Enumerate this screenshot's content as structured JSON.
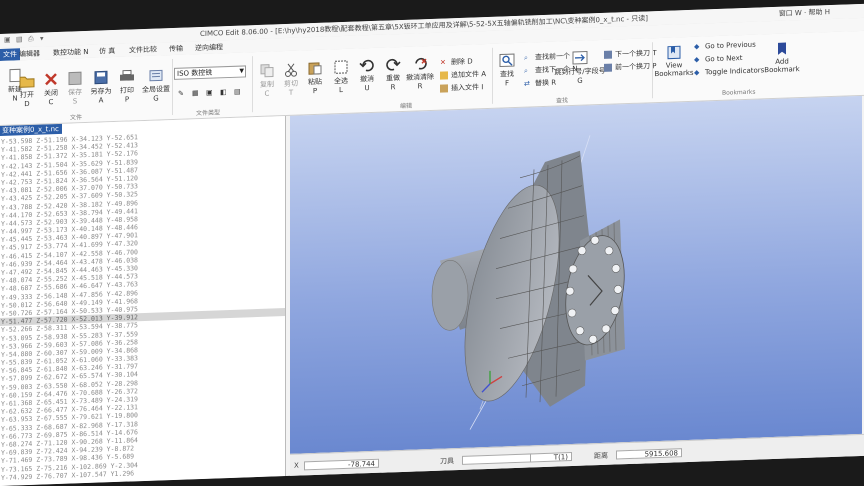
{
  "window": {
    "title": "CIMCO Edit 8.06.00 - [E:\\hy\\hy2018教程\\配套教程\\第五章\\5X钣环工单应用及详解\\5-52-5X五轴偏轨铣削加工\\NC\\变种案例0_x_t.nc - 只读]",
    "user_menu": "窗口 W · 帮助 H"
  },
  "menu": {
    "tabs": [
      "文件",
      "编辑器",
      "数控功能 N",
      "仿 真",
      "文件比较",
      "传输",
      "逆向编程"
    ],
    "active": "文件"
  },
  "ribbon": {
    "file_buttons": [
      {
        "label": "新建",
        "key": "N"
      },
      {
        "label": "打开",
        "key": "D"
      },
      {
        "label": "关闭",
        "key": "C"
      },
      {
        "label": "保存",
        "key": "S"
      },
      {
        "label": "另存为",
        "key": "A"
      },
      {
        "label": "打印",
        "key": "P"
      },
      {
        "label": "全局设置",
        "key": "G"
      }
    ],
    "file_group": "文件",
    "combo_value": "ISO 数控铣",
    "filetype_group": "文件类型",
    "edit_buttons": [
      {
        "label": "复制",
        "key": "C"
      },
      {
        "label": "剪切",
        "key": "T"
      },
      {
        "label": "粘贴",
        "key": "P"
      },
      {
        "label": "全选",
        "key": "L"
      },
      {
        "label": "撤消",
        "key": "U"
      },
      {
        "label": "重做",
        "key": "R"
      },
      {
        "label": "撤消清除",
        "key": "R"
      }
    ],
    "edit_small": [
      "删除 D",
      "追加文件 A",
      "插入文件 I"
    ],
    "edit_group": "编辑",
    "find_button": {
      "label": "查找",
      "key": "F"
    },
    "find_small": [
      "查找前一个 P",
      "查找下一个 N",
      "替换 R"
    ],
    "goto_label": "跳到行号/字段号",
    "goto_key": "G",
    "tool_small": [
      "下一个换刀 T",
      "前一个换刀 P"
    ],
    "find_group": "查找",
    "bookmarks_view": "View Bookmarks",
    "bookmark_small": [
      "Go to Previous",
      "Go to Next",
      "Toggle Indicators"
    ],
    "add_bookmark": "Add Bookmark",
    "bookmarks_group": "Bookmarks"
  },
  "editor": {
    "tab": "变种案例0_x_t.nc",
    "lines": [
      "Y-53.598 Z-51.196 X-34.123 Y-52.651",
      "Y-41.582 Z-51.258 X-34.452 Y-52.413",
      "Y-41.858 Z-51.372 X-35.181 Y-52.176",
      "Y-42.143 Z-51.504 X-35.629 Y-51.839",
      "Y-42.441 Z-51.656 X-36.087 Y-51.487",
      "Y-42.753 Z-51.824 X-36.564 Y-51.120",
      "Y-43.081 Z-52.006 X-37.070 Y-50.733",
      "Y-43.425 Z-52.205 X-37.609 Y-50.325",
      "Y-43.788 Z-52.420 X-38.182 Y-49.896",
      "Y-44.170 Z-52.653 X-38.794 Y-49.441",
      "Y-44.573 Z-52.903 X-39.448 Y-48.958",
      "Y-44.997 Z-53.173 X-40.148 Y-48.446",
      "Y-45.445 Z-53.463 X-40.897 Y-47.901",
      "Y-45.917 Z-53.774 X-41.699 Y-47.320",
      "Y-46.415 Z-54.107 X-42.558 Y-46.700",
      "Y-46.939 Z-54.464 X-43.478 Y-46.038",
      "Y-47.492 Z-54.845 X-44.463 Y-45.330",
      "Y-48.074 Z-55.252 X-45.518 Y-44.573",
      "Y-48.687 Z-55.686 X-46.647 Y-43.763",
      "Y-49.333 Z-56.148 X-47.856 Y-42.896",
      "Y-50.012 Z-56.640 X-49.149 Y-41.968",
      "Y-50.726 Z-57.164 X-50.533 Y-40.975",
      "Y-51.477 Z-57.720 X-52.013 Y-39.912",
      "Y-52.266 Z-58.311 X-53.594 Y-38.775",
      "Y-53.095 Z-58.938 X-55.283 Y-37.559",
      "Y-53.966 Z-59.603 X-57.086 Y-36.258",
      "Y-54.880 Z-60.307 X-59.009 Y-34.868",
      "Y-55.839 Z-61.052 X-61.060 Y-33.383",
      "Y-56.845 Z-61.840 X-63.246 Y-31.797",
      "Y-57.899 Z-62.672 X-65.574 Y-30.104",
      "Y-59.003 Z-63.550 X-68.052 Y-28.298",
      "Y-60.159 Z-64.476 X-70.688 Y-26.372",
      "Y-61.368 Z-65.451 X-73.489 Y-24.319",
      "Y-62.632 Z-66.477 X-76.464 Y-22.131",
      "Y-63.953 Z-67.555 X-79.621 Y-19.800",
      "Y-65.333 Z-68.687 X-82.968 Y-17.318",
      "Y-66.773 Z-69.875 X-86.514 Y-14.676",
      "Y-68.274 Z-71.120 X-90.268 Y-11.864",
      "Y-69.839 Z-72.424 X-94.239 Y-8.872",
      "Y-71.469 Z-73.789 X-98.436 Y-5.689",
      "Y-73.165 Z-75.216 X-102.869 Y-2.304",
      "Y-74.929 Z-76.707 X-107.547 Y1.296"
    ],
    "highlight_index": 22
  },
  "status": {
    "x_value": "-78.744",
    "tool_label": "刀具",
    "t_value": "T(1)",
    "dist_label": "距离",
    "dist_value": "5915.608"
  },
  "colors": {
    "accent": "#2c5ea8",
    "viewport_top": "#c6d3f0",
    "viewport_bottom": "#6a88d0",
    "part": "#8e949d"
  }
}
